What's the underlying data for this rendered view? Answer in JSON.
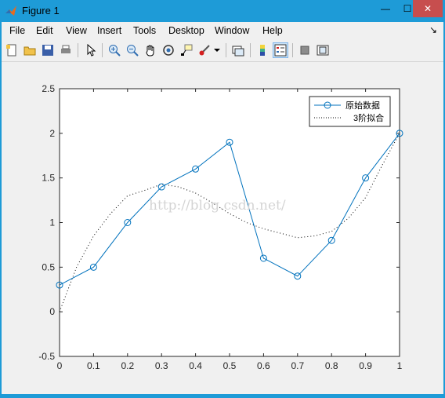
{
  "window": {
    "title": "Figure 1",
    "minimize_glyph": "—",
    "maximize_glyph": "☐",
    "close_glyph": "✕"
  },
  "menu": {
    "items": [
      "File",
      "Edit",
      "View",
      "Insert",
      "Tools",
      "Desktop",
      "Window",
      "Help"
    ],
    "dock_glyph": "↘"
  },
  "toolbar": {
    "icons": [
      "new-figure-icon",
      "open-file-icon",
      "save-icon",
      "print-icon",
      "pointer-icon",
      "zoom-in-icon",
      "zoom-out-icon",
      "pan-hand-icon",
      "rotate-3d-icon",
      "data-cursor-icon",
      "brush-icon",
      "brush-dropdown-icon",
      "link-plot-icon",
      "colorbar-icon",
      "legend-icon",
      "hide-plot-tools-icon",
      "show-plot-tools-icon"
    ]
  },
  "watermark": "http://blog.csdn.net/",
  "chart_data": {
    "type": "line",
    "title": "",
    "xlabel": "",
    "ylabel": "",
    "xlim": [
      0,
      1
    ],
    "ylim": [
      -0.5,
      2.5
    ],
    "xticks": [
      "0",
      "0.1",
      "0.2",
      "0.3",
      "0.4",
      "0.5",
      "0.6",
      "0.7",
      "0.8",
      "0.9",
      "1"
    ],
    "yticks": [
      "-0.5",
      "0",
      "0.5",
      "1",
      "1.5",
      "2",
      "2.5"
    ],
    "grid": false,
    "legend_position": "top-right",
    "series": [
      {
        "name": "原始数据",
        "color": "#0072bd",
        "style": "solid-circle-markers",
        "x": [
          0,
          0.1,
          0.2,
          0.3,
          0.4,
          0.5,
          0.6,
          0.7,
          0.8,
          0.9,
          1
        ],
        "y": [
          0.3,
          0.5,
          1.0,
          1.4,
          1.6,
          1.9,
          0.6,
          0.4,
          0.8,
          1.5,
          2.0
        ]
      },
      {
        "name": "3阶拟合",
        "color": "#000000",
        "style": "dotted",
        "x": [
          0,
          0.05,
          0.1,
          0.15,
          0.2,
          0.25,
          0.3,
          0.35,
          0.4,
          0.45,
          0.5,
          0.55,
          0.6,
          0.65,
          0.7,
          0.75,
          0.8,
          0.85,
          0.9,
          0.95,
          1
        ],
        "y": [
          0.0,
          0.5,
          0.85,
          1.1,
          1.3,
          1.36,
          1.43,
          1.4,
          1.33,
          1.22,
          1.1,
          1.0,
          0.93,
          0.88,
          0.83,
          0.85,
          0.9,
          1.05,
          1.28,
          1.65,
          2.0
        ]
      }
    ]
  }
}
